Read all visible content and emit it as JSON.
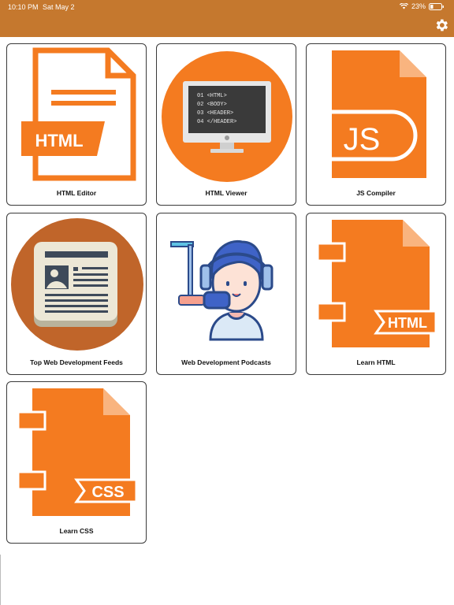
{
  "status_bar": {
    "time": "10:10 PM",
    "date": "Sat May 2",
    "battery": "23%"
  },
  "header": {
    "settings_icon": "gear-icon"
  },
  "tiles": [
    {
      "label": "HTML Editor",
      "icon": "html-file-icon"
    },
    {
      "label": "HTML Viewer",
      "icon": "monitor-code-icon"
    },
    {
      "label": "JS Compiler",
      "icon": "js-file-icon"
    },
    {
      "label": "Top Web Development Feeds",
      "icon": "newspaper-icon"
    },
    {
      "label": "Web Development Podcasts",
      "icon": "podcaster-icon"
    },
    {
      "label": "Learn HTML",
      "icon": "html-notebook-icon"
    },
    {
      "label": "Learn CSS",
      "icon": "css-notebook-icon"
    }
  ],
  "art_text": {
    "html_badge": "HTML",
    "js_badge": "JS",
    "css_badge": "CSS",
    "code_lines": [
      "01 <HTML>",
      "02 <BODY>",
      "03 <HEADER>",
      "04 </HEADER>"
    ]
  },
  "colors": {
    "header": "#c5782e",
    "accent": "#f47b20",
    "dark_accent": "#c0652a"
  }
}
